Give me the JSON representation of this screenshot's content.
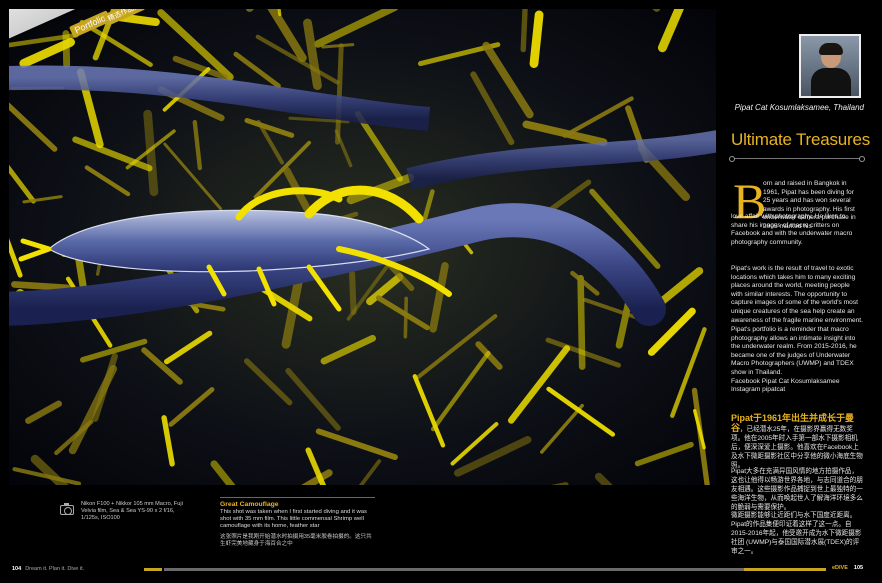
{
  "tab": {
    "section": "Portfolio",
    "section_cn": "精选作品集"
  },
  "author": {
    "name": "Pipat Cat Kosumlaksamee, Thailand"
  },
  "article": {
    "headline": "Ultimate Treasures",
    "dropcap": "B",
    "p1_lead": "orn and raised in Bangkok in 1961, Pipat has been diving for 25 years and has won several awards in photography. His first underwater camera purchase in 2005 marked his",
    "p1_rest": "love affair with photography. He likes to share his images of macro critters on Facebook and with the underwater macro photography community.",
    "p2": "Pipat's work is the result of travel to exotic locations which takes him to many exciting places around the world, meeting people with similar interests. The opportunity to capture images of some of the world's most unique creatures of the sea help create an awareness of the fragile marine environment.",
    "p3": "Pipat's portfolio is a reminder that macro photography allows an intimate insight into the underwater realm. From 2015-2016, he became one of the judges of Underwater Macro Photographers (UWMP) and TDEX show in Thailand.",
    "facebook": "Facebook Pipat Cat Kosumlaksamee",
    "instagram": "Instagram  pipatcat",
    "cn_highlight": "Pipat于1961年出生并成长于曼谷",
    "cn_p1": "，已经潜水25年，在摄影界赢得无数奖项。他在2005年时入手第一部水下摄影相机后，便深深爱上摄影。他喜欢在Facebook上及水下微距摄影社区中分享他的微小海底生物照。",
    "cn_p2": "Pipat大多在充满异国风情的地方拍摄作品，这也让他得以畅游世界各地，与志同道合的朋友相遇。这些摄影作品捕捉到世上最独特的一些海洋生物，从而唤起世人了解海洋环境多么的脆弱与需要保护。",
    "cn_p3": "微距摄影能够让近距们与水下国度近距离。Pipat的作品集便印证着这样了这一点。自2015-2016年起，他受邀开成为水下微距摄影社团 (UWMP)与泰国国际潜水展(TDEX)的评审之一。"
  },
  "caption": {
    "specs": "Nikon F100 + Nikkor 105 mm Macro, Fuji Velvia film, Sea & Sea YS-90 x 2 f/16, 1/125s, ISO100",
    "title": "Great Camouflage",
    "text": "This shot was taken when I first started diving and it was shot with 35 mm film. This little commensal Shrimp well camouflage with its home, feather star",
    "cn": "这张照片是我刚开始潜水时拍摄用35毫米胶卷拍摄的。这只共生虾完美地藏身于海百合之中"
  },
  "footer": {
    "left_page": "104",
    "left_text": "Dream it. Plan it. Dive it.",
    "brand": "eDIVE",
    "right_page": "105"
  },
  "colors": {
    "accent": "#e8b321",
    "background": "#000000"
  }
}
